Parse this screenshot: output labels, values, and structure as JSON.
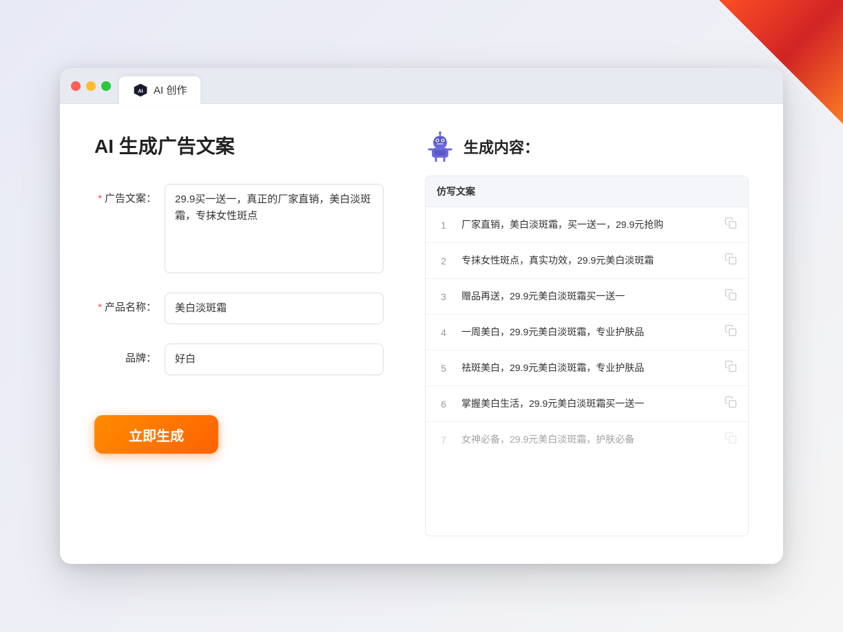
{
  "window": {
    "tab_title": "AI 创作"
  },
  "page": {
    "title": "AI 生成广告文案",
    "result_section_label": "生成内容："
  },
  "form": {
    "ad_copy_label": "广告文案：",
    "ad_copy_required": "*",
    "ad_copy_value": "29.9买一送一，真正的厂家直销，美白淡斑霜，专抹女性斑点",
    "product_name_label": "产品名称：",
    "product_name_required": "*",
    "product_name_value": "美白淡斑霜",
    "brand_label": "品牌：",
    "brand_value": "好白",
    "generate_button_label": "立即生成"
  },
  "results": {
    "column_header": "仿写文案",
    "items": [
      {
        "index": 1,
        "text": "厂家直销，美白淡斑霜，买一送一，29.9元抢购"
      },
      {
        "index": 2,
        "text": "专抹女性斑点，真实功效，29.9元美白淡斑霜"
      },
      {
        "index": 3,
        "text": "赠品再送，29.9元美白淡斑霜买一送一"
      },
      {
        "index": 4,
        "text": "一周美白，29.9元美白淡斑霜，专业护肤品"
      },
      {
        "index": 5,
        "text": "祛斑美白，29.9元美白淡斑霜，专业护肤品"
      },
      {
        "index": 6,
        "text": "掌握美白生活，29.9元美白淡斑霜买一送一"
      },
      {
        "index": 7,
        "text": "女神必备，29.9元美白淡斑霜，护肤必备",
        "dimmed": true
      }
    ]
  },
  "colors": {
    "accent": "#ff6200",
    "required": "#ff4d4f",
    "border": "#d9dde8"
  }
}
